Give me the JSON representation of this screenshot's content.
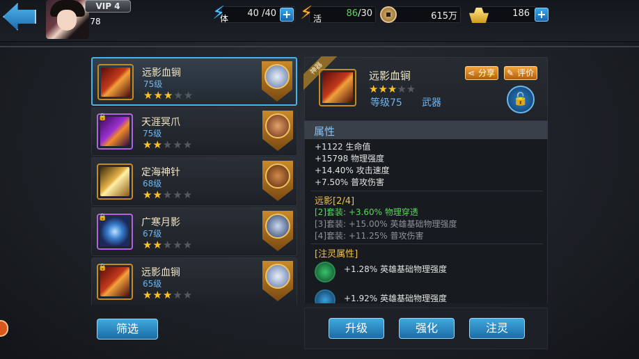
{
  "topbar": {
    "vip": "VIP 4",
    "player_level": "78",
    "stamina": {
      "label": "体",
      "value": "40 /40"
    },
    "vigor": {
      "label": "活",
      "current": "86",
      "max": "/30"
    },
    "copper": {
      "value": "615万"
    },
    "ingot": {
      "value": "186"
    },
    "plus": "+"
  },
  "equipment_list": [
    {
      "name": "远影血锏",
      "level": "75级",
      "stars": 3,
      "selected": true,
      "locked": false
    },
    {
      "name": "天涯冥爪",
      "level": "75级",
      "stars": 2,
      "selected": false,
      "locked": true
    },
    {
      "name": "定海神针",
      "level": "68级",
      "stars": 2,
      "selected": false,
      "locked": false
    },
    {
      "name": "广寒月影",
      "level": "67级",
      "stars": 2,
      "selected": false,
      "locked": true
    },
    {
      "name": "远影血锏",
      "level": "65级",
      "stars": 3,
      "selected": false,
      "locked": true
    }
  ],
  "filter_button": "筛选",
  "detail": {
    "ribbon": "神器",
    "name": "远影血锏",
    "stars": 3,
    "level": "等级75",
    "type": "武器",
    "share": "分享",
    "review": "评价",
    "attr_title": "属性",
    "base_stats": [
      "+1122 生命值",
      "+15798 物理强度",
      "+14.40% 攻击速度",
      "+7.50% 普攻伤害"
    ],
    "set_title": "远影[2/4]",
    "set_bonuses": [
      {
        "text": "[2]套装: +3.60% 物理穿透",
        "active": true
      },
      {
        "text": "[3]套装: +15.00% 英雄基础物理强度",
        "active": false
      },
      {
        "text": "[4]套装: +11.25% 普攻伤害",
        "active": false
      }
    ],
    "spirit_title": "[注灵属性]",
    "spirit_stats": [
      "+1.28% 英雄基础物理强度",
      "+1.92% 英雄基础物理强度"
    ]
  },
  "actions": {
    "upgrade": "升级",
    "enhance": "强化",
    "infuse": "注灵"
  },
  "icons": {
    "back": "back-arrow-icon",
    "lock": "unlock-icon",
    "share": "share-icon",
    "review": "edit-icon"
  },
  "colors": {
    "accent_blue": "#3fa9de",
    "star_gold": "#ffc21e",
    "set_active": "#58d85b",
    "orange_button": "#f2a33a"
  }
}
